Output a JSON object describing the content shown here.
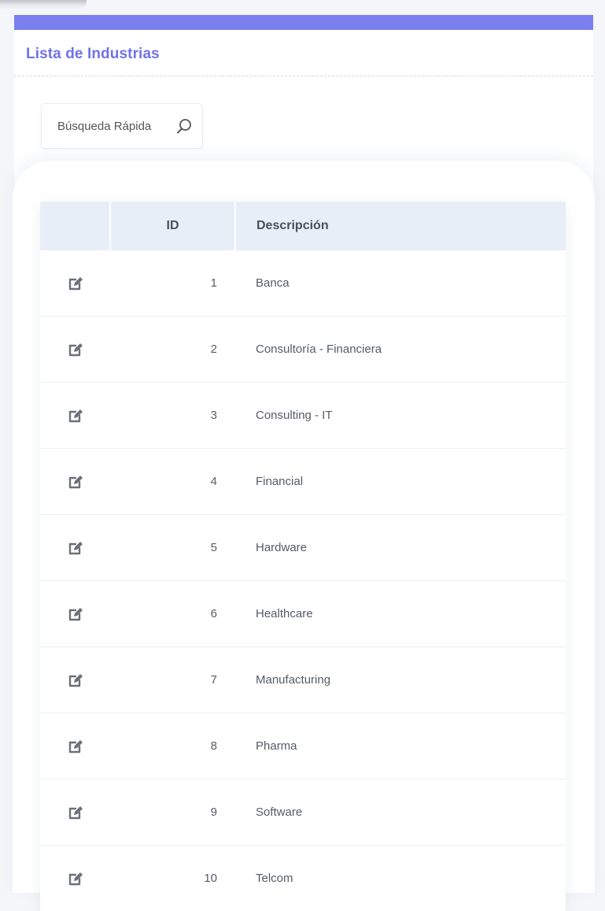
{
  "panel": {
    "title": "Lista de Industrias",
    "accent_color": "#7b7ff0"
  },
  "search": {
    "placeholder": "Búsqueda Rápida",
    "icon": "search-icon"
  },
  "table": {
    "headers": {
      "edit": "",
      "id": "ID",
      "description": "Descripción"
    },
    "header_bg": "#e8eef8",
    "row_icon": "edit-icon",
    "rows": [
      {
        "id": "1",
        "description": "Banca"
      },
      {
        "id": "2",
        "description": "Consultoría - Financiera"
      },
      {
        "id": "3",
        "description": "Consulting - IT"
      },
      {
        "id": "4",
        "description": "Financial"
      },
      {
        "id": "5",
        "description": "Hardware"
      },
      {
        "id": "6",
        "description": "Healthcare"
      },
      {
        "id": "7",
        "description": "Manufacturing"
      },
      {
        "id": "8",
        "description": "Pharma"
      },
      {
        "id": "9",
        "description": "Software"
      },
      {
        "id": "10",
        "description": "Telcom"
      }
    ]
  }
}
